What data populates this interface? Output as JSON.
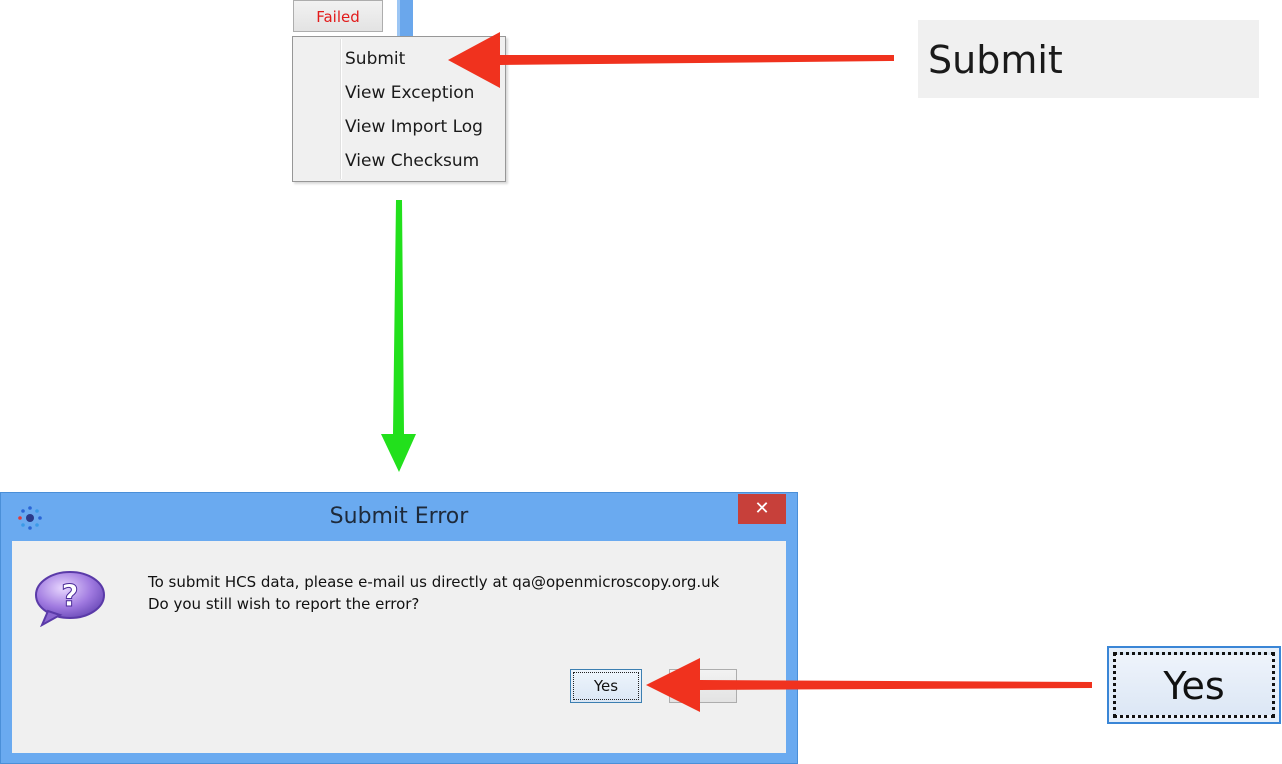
{
  "top": {
    "failed_label": "Failed",
    "menu_items": [
      "Submit",
      "View Exception",
      "View Import Log",
      "View Checksum"
    ]
  },
  "zoom": {
    "submit_label": "Submit",
    "yes_label": "Yes"
  },
  "dialog": {
    "title": "Submit Error",
    "close_glyph": "✕",
    "message_line1": "To submit HCS data, please e-mail us directly at qa@openmicroscopy.org.uk",
    "message_line2": "Do you still wish to report the error?",
    "yes_label": "Yes"
  },
  "colors": {
    "arrow_red": "#f0321e",
    "arrow_green": "#22e01c",
    "title_bar": "#6aaaf0",
    "close_red": "#c7403a",
    "failed_text": "#e21b1b"
  },
  "icons": [
    "app-logo-icon",
    "close-icon",
    "question-bubble-icon",
    "pointer-arrow"
  ]
}
